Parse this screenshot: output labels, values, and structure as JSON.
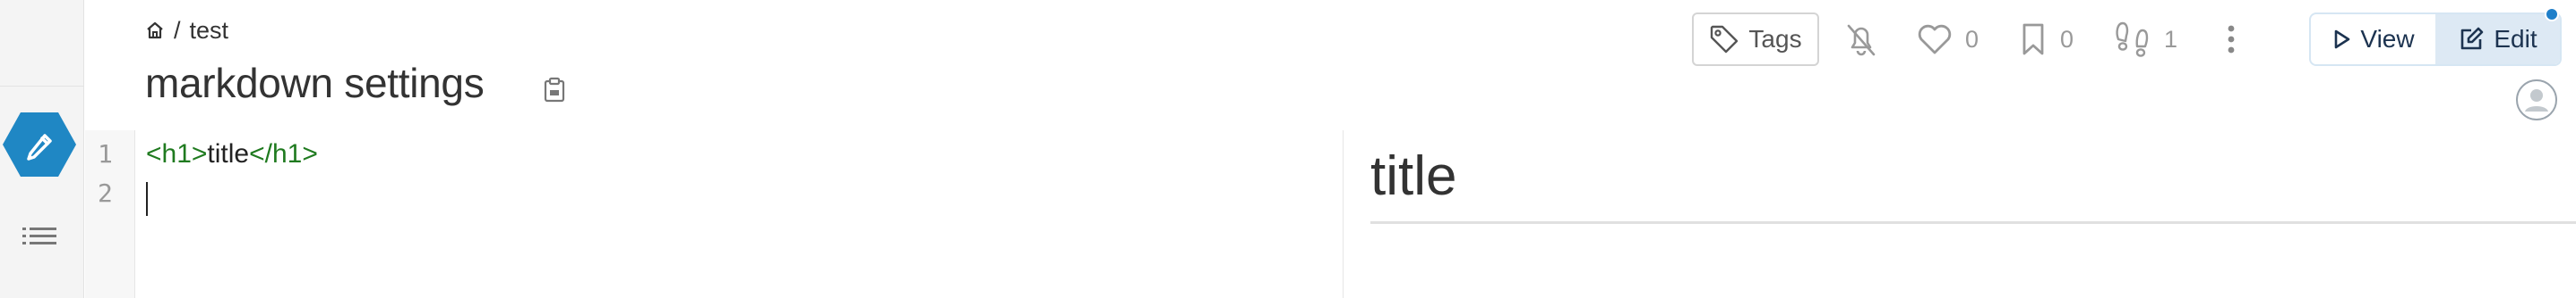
{
  "breadcrumb": {
    "separator": "/",
    "page": "test"
  },
  "page": {
    "title": "markdown settings"
  },
  "toolbar": {
    "tags_label": "Tags",
    "likes_count": "0",
    "bookmarks_count": "0",
    "seen_count": "1",
    "view_label": "View",
    "edit_label": "Edit",
    "active_mode": "Edit"
  },
  "editor": {
    "lines": [
      {
        "number": "1",
        "open_tag": "<h1>",
        "text": "title",
        "close_tag": "</h1>"
      },
      {
        "number": "2",
        "text": ""
      }
    ]
  },
  "preview": {
    "heading": "title"
  },
  "icons": {
    "home": "home-icon",
    "clipboard": "clipboard-icon",
    "tag": "tag-icon",
    "bell_off": "bell-off-icon",
    "heart": "heart-icon",
    "bookmark": "bookmark-icon",
    "footprints": "footprints-icon",
    "more": "more-vertical-icon",
    "play": "play-icon",
    "edit": "edit-icon",
    "pencil": "pencil-icon",
    "list": "list-icon",
    "user": "user-icon"
  },
  "colors": {
    "accent": "#1f87c4",
    "tag_green": "#1f7a1f",
    "active_toggle_bg": "#dde9f4",
    "status_dot": "#1f7fc9"
  }
}
